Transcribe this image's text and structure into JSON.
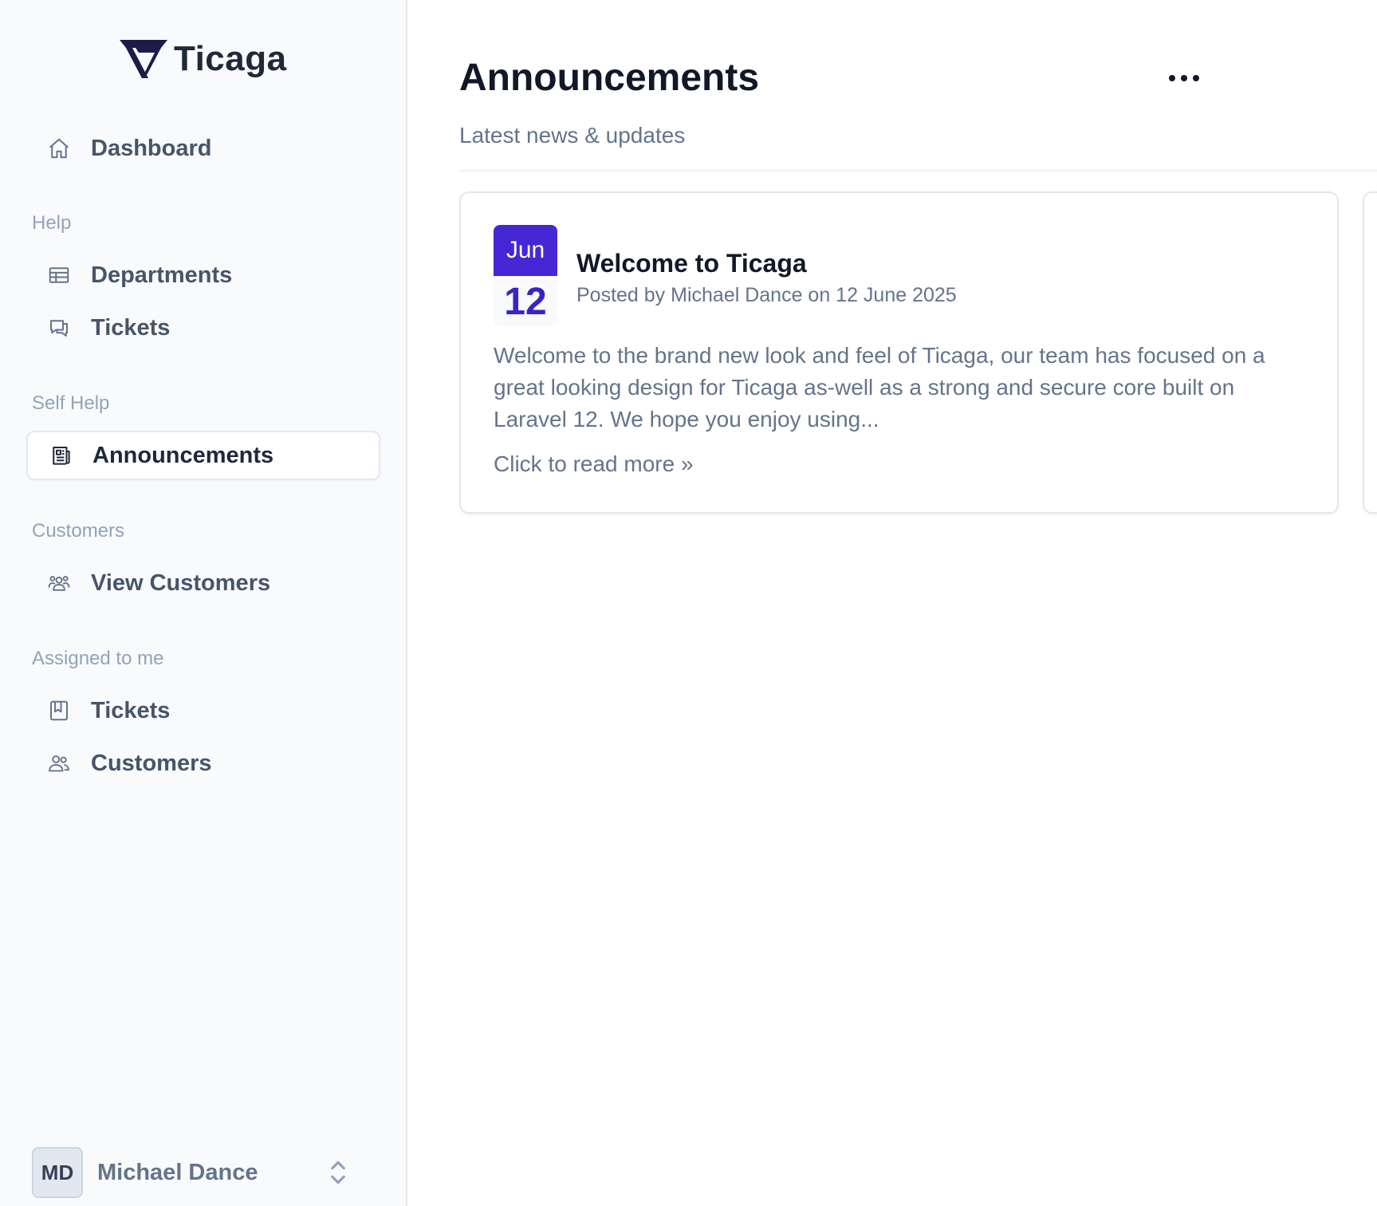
{
  "brand": {
    "name": "Ticaga"
  },
  "sidebar": {
    "dashboard": "Dashboard",
    "sections": {
      "help": "Help",
      "self_help": "Self Help",
      "customers": "Customers",
      "assigned": "Assigned to me"
    },
    "items": {
      "departments": "Departments",
      "tickets": "Tickets",
      "announcements": "Announcements",
      "view_customers": "View Customers",
      "assigned_tickets": "Tickets",
      "assigned_customers": "Customers"
    },
    "active_item": "announcements"
  },
  "user": {
    "initials": "MD",
    "name": "Michael Dance"
  },
  "main": {
    "title": "Announcements",
    "subtitle": "Latest news & updates",
    "announcements": [
      {
        "month": "Jun",
        "day": "12",
        "title": "Welcome to Ticaga",
        "meta": "Posted by Michael Dance on 12 June 2025",
        "excerpt": "Welcome to the brand new look and feel of Ticaga, our team has focused on a great looking design for Ticaga as-well as a strong and secure core built on Laravel 12. We hope you enjoy using...",
        "read_more": "Click to read more »"
      }
    ]
  },
  "colors": {
    "accent": "#4527d6",
    "sidebar_bg": "#f8fafc",
    "text_muted": "#64748b",
    "logo_navy": "#1e1b4b"
  },
  "icons": {
    "dashboard": "home-icon",
    "departments": "table-icon",
    "tickets": "chat-bubbles-icon",
    "announcements": "newspaper-icon",
    "view_customers": "user-group-icon",
    "assigned_tickets": "bookmark-square-icon",
    "assigned_customers": "users-icon",
    "more": "ellipsis-icon",
    "user_menu": "chevron-up-down-icon"
  }
}
